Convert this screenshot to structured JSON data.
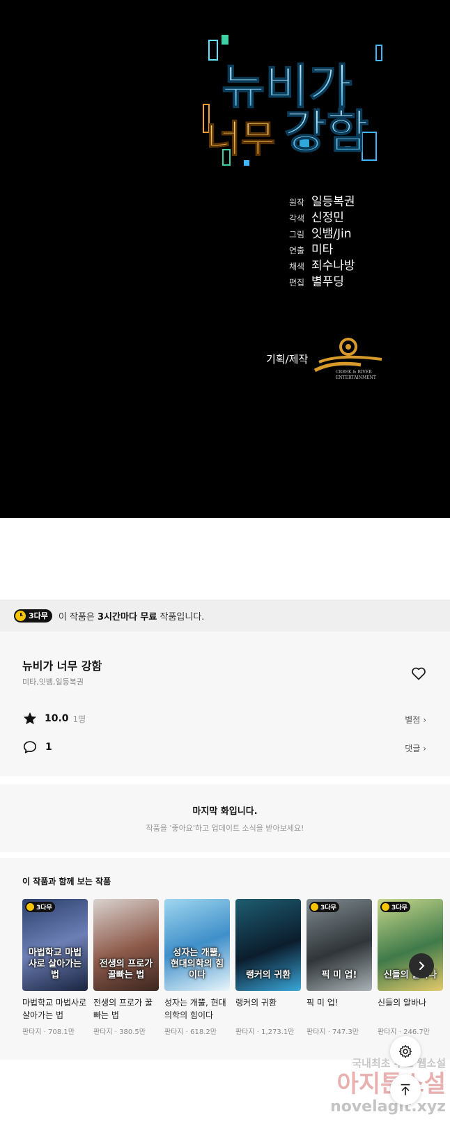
{
  "hero": {
    "title_line1": "뉴비가",
    "title_line2_a": "너무",
    "title_line2_b": "강함",
    "credits": [
      {
        "role": "원작",
        "name": "일등복권"
      },
      {
        "role": "각색",
        "name": "신정민"
      },
      {
        "role": "그림",
        "name": "잇뱀/Jin"
      },
      {
        "role": "연출",
        "name": "미타"
      },
      {
        "role": "채색",
        "name": "죄수나방"
      },
      {
        "role": "편집",
        "name": "별푸딩"
      }
    ],
    "planning_label": "기획/제작",
    "company_line1": "CREEK & RIVER",
    "company_line2": "ENTERTAINMENT"
  },
  "free_banner": {
    "badge": "3다무",
    "text_before": "이 작품은 ",
    "text_bold": "3시간마다 무료",
    "text_after": " 작품입니다."
  },
  "work": {
    "title": "뉴비가 너무 강함",
    "authors": "미타,잇뱀,일등복권",
    "rating": "10.0",
    "rating_count": "1명",
    "rating_link": "별점",
    "comment_count": "1",
    "comment_link": "댓글"
  },
  "last_episode": {
    "title": "마지막 화입니다.",
    "subtitle": "작품을 '좋아요'하고 업데이트 소식을 받아보세요!"
  },
  "recommendations": {
    "title": "이 작품과 함께 보는 작품",
    "items": [
      {
        "badge": "3다무",
        "cover_text": "마법학교 마법사로 살아가는 법",
        "name": "마법학교 마법사로 살아가는 법",
        "meta": "판타지 · 708.1만"
      },
      {
        "badge": "",
        "cover_text": "전생의 프로가 꿀빠는 법",
        "name": "전생의 프로가 꿀빠는 법",
        "meta": "판타지 · 380.5만"
      },
      {
        "badge": "",
        "cover_text": "성자는 개뿔, 현대의학의 힘이다",
        "name": "성자는 개뿔, 현대의학의 힘이다",
        "meta": "판타지 · 618.2만"
      },
      {
        "badge": "",
        "cover_text": "랭커의 귀환",
        "name": "랭커의 귀환",
        "meta": "판타지 · 1,273.1만"
      },
      {
        "badge": "3다무",
        "cover_text": "픽 미 업!",
        "name": "픽 미 업!",
        "meta": "판타지 · 747.3만"
      },
      {
        "badge": "3다무",
        "cover_text": "신들의 알바나",
        "name": "신들의 알바나",
        "meta": "판타지 · 246.7만"
      }
    ]
  },
  "watermark": {
    "line1": "국내최초 무료 웹소설",
    "line2": "아지툰소설",
    "line3": "novelagit.xyz"
  },
  "colors": {
    "accent_yellow": "#f7c400",
    "hero_bg": "#000000",
    "section_bg": "#f7f7f7"
  },
  "icons": [
    "clock-icon",
    "chevron-right-icon",
    "heart-icon",
    "star-icon",
    "comment-icon",
    "chevron-right-icon",
    "gear-icon",
    "arrow-up-icon"
  ]
}
